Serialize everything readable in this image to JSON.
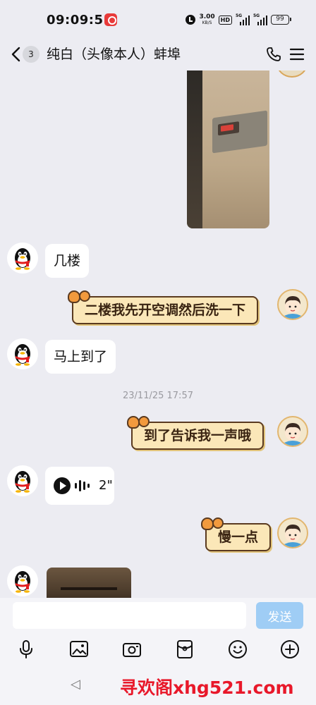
{
  "status_bar": {
    "time": "09:09:51",
    "net_speed": "3.00",
    "net_unit": "KB/S",
    "hd": "HD",
    "sim1": "5G",
    "sim2": "5G",
    "battery": "99"
  },
  "header": {
    "unread_count": "3",
    "title": "纯白（头像本人）蚌埠"
  },
  "messages": [
    {
      "side": "left",
      "type": "text",
      "text": "几楼"
    },
    {
      "side": "right",
      "type": "text",
      "text": "二楼我先开空调然后洗一下"
    },
    {
      "side": "left",
      "type": "text",
      "text": "马上到了"
    },
    {
      "type": "timestamp",
      "text": "23/11/25 17:57"
    },
    {
      "side": "right",
      "type": "text",
      "text": "到了告诉我一声哦"
    },
    {
      "side": "left",
      "type": "voice",
      "duration": "2\""
    },
    {
      "side": "right",
      "type": "text",
      "text": "慢一点"
    }
  ],
  "input": {
    "placeholder": "",
    "send_label": "发送"
  },
  "toolbar": [
    "microphone-icon",
    "image-icon",
    "camera-icon",
    "red-packet-icon",
    "emoji-icon",
    "plus-icon"
  ],
  "nav": {
    "back_glyph": "◁"
  },
  "watermark": "寻欢阁xhg521.com",
  "colors": {
    "background": "#ececf2",
    "send_button": "#9fcdf5",
    "bubble_cat": "#fbe7b8",
    "watermark": "#e8182a"
  }
}
